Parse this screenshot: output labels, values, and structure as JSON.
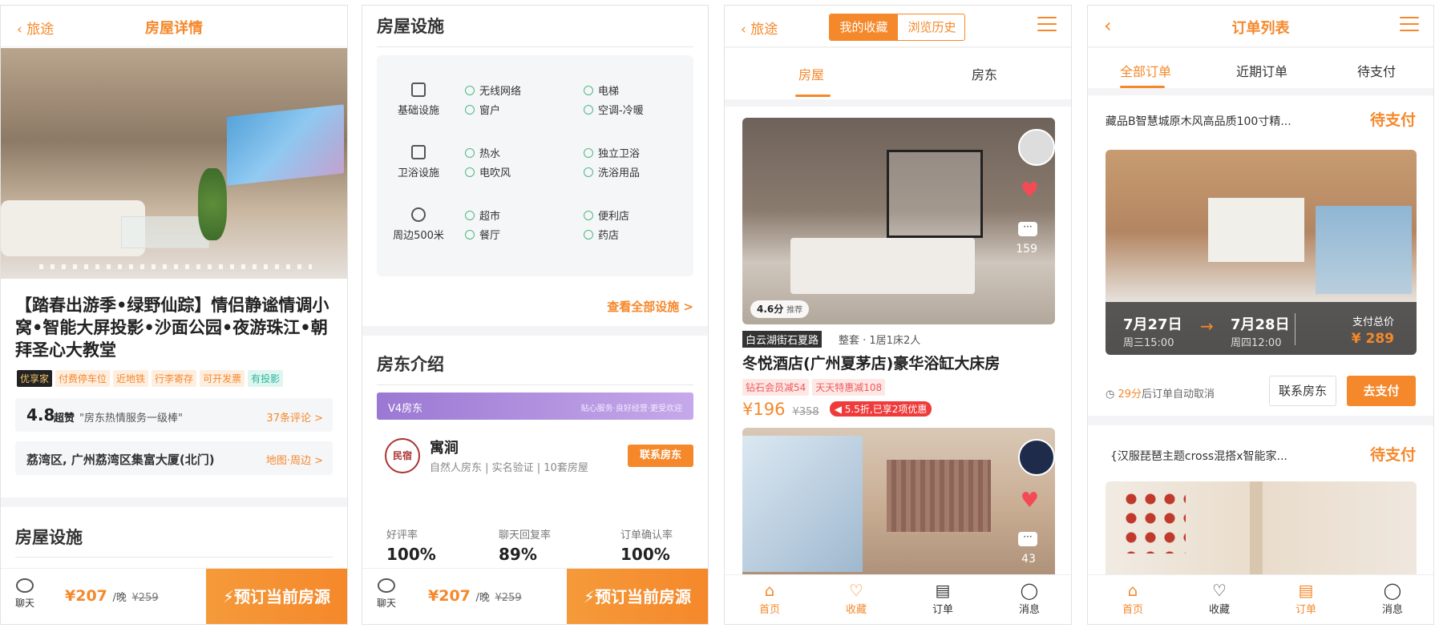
{
  "screen1": {
    "back_label": "旅途",
    "title": "房屋详情",
    "listing_title": "【踏春出游季•绿野仙踪】情侣静谧情调小窝•智能大屏投影•沙面公园•夜游珠江•朝拜圣心大教堂",
    "tags": [
      "优享家",
      "付费停车位",
      "近地铁",
      "行李寄存",
      "可开发票",
      "有投影"
    ],
    "rating_score": "4.8",
    "rating_level": "超赞",
    "rating_quote": "\"房东热情服务一级棒\"",
    "review_link": "37条评论 >",
    "address": "荔湾区, 广州荔湾区集富大厦(北门)",
    "map_link": "地图·周边 >",
    "facilities_title": "房屋设施",
    "chat_label": "聊天",
    "price": "¥207",
    "per_night": "/晚",
    "original_price": "¥259",
    "book_label": "预订当前房源"
  },
  "screen2": {
    "facilities_title": "房屋设施",
    "facility_groups": [
      {
        "category": "基础设施",
        "items": [
          "无线网络",
          "电梯",
          "窗户",
          "空调-冷暖"
        ]
      },
      {
        "category": "卫浴设施",
        "items": [
          "热水",
          "独立卫浴",
          "电吹风",
          "洗浴用品"
        ]
      },
      {
        "category": "周边500米",
        "items": [
          "超市",
          "便利店",
          "餐厅",
          "药店"
        ]
      }
    ],
    "view_all": "查看全部设施 >",
    "host_intro_title": "房东介绍",
    "host_level": "V4房东",
    "host_slogan": "贴心服务·良好经营·更受欢迎",
    "host_logo_text": "民宿",
    "host_name": "寓涧",
    "host_desc": "自然人房东 | 实名验证 | 10套房屋",
    "contact_host": "联系房东",
    "stats": [
      {
        "label": "好评率",
        "value": "100%"
      },
      {
        "label": "聊天回复率",
        "value": "89%"
      },
      {
        "label": "订单确认率",
        "value": "100%"
      }
    ],
    "chat_label": "聊天",
    "price": "¥207",
    "per_night": "/晚",
    "original_price": "¥259",
    "book_label": "预订当前房源"
  },
  "screen3": {
    "back_label": "旅途",
    "segment": [
      "我的收藏",
      "浏览历史"
    ],
    "tabs": [
      "房屋",
      "房东"
    ],
    "card1": {
      "score": "4.6分",
      "score_tag": "推荐",
      "comment_count": "159",
      "location": "白云湖街石夏路",
      "room_type": "整套 · 1居1床2人",
      "name": "冬悦酒店(广州夏茅店)豪华浴缸大床房",
      "promos": [
        "钻石会员减54",
        "天天特惠减108"
      ],
      "price": "¥196",
      "original_price": "¥358",
      "discount": "5.5折,已享2项优惠"
    },
    "card2": {
      "comment_count": "43"
    },
    "nav": [
      "首页",
      "收藏",
      "订单",
      "消息"
    ]
  },
  "screen4": {
    "title": "订单列表",
    "tabs": [
      "全部订单",
      "近期订单",
      "待支付"
    ],
    "order1": {
      "name": "藏品B智慧城原木风高品质100寸精...",
      "status": "待支付",
      "checkin_date": "7月27日",
      "checkin_time": "周三15:00",
      "checkout_date": "7月28日",
      "checkout_time": "周四12:00",
      "total_label": "支付总价",
      "total": "¥ 289",
      "countdown": "29分",
      "countdown_suffix": "后订单自动取消",
      "contact": "联系房东",
      "pay": "去支付"
    },
    "order2": {
      "name": "{汉服琵琶主题cross混搭x智能家...",
      "status": "待支付"
    },
    "nav": [
      "首页",
      "收藏",
      "订单",
      "消息"
    ]
  },
  "colors": {
    "accent": "#f5882b",
    "host_banner": "#a985d6",
    "facility_check": "#4cba82"
  }
}
